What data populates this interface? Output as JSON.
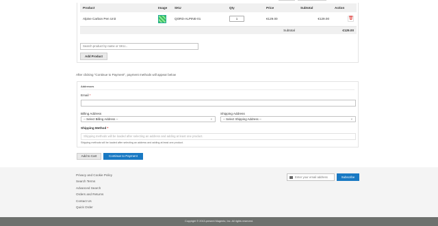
{
  "table": {
    "headers": [
      "Product",
      "Image",
      "SKU",
      "Qty",
      "Price",
      "Subtotal",
      "Action"
    ],
    "rows": [
      {
        "product": "Alpine Carbon Pen Unit",
        "sku": "QORD-ALPINE-01",
        "qty": "1",
        "price": "€129.00",
        "subtotal": "€129.00"
      }
    ],
    "subtotal_label": "Subtotal",
    "subtotal_value": "€129.00"
  },
  "search": {
    "placeholder": "Search product by name or SKU..."
  },
  "add_product_label": "Add Product",
  "payment_note": "After clicking \"Continue to Payment\", payment methods will appear below",
  "addresses": {
    "title": "Addresses",
    "email_label": "Email",
    "required_mark": "*",
    "billing_label": "Billing Address",
    "billing_selected": "-- Select Billing Address --",
    "shipping_label": "Shipping Address",
    "shipping_selected": "-- Select Shipping Address --",
    "shipping_method_label": "Shipping Method",
    "shipping_method_placeholder": "Shipping methods will be loaded after selecting an address and adding at least one product.",
    "shipping_method_note": "Shipping methods will be loaded after selecting an address and adding at least one product."
  },
  "buttons": {
    "add_to_cart": "Add to Cart",
    "continue_to_payment": "Continue to Payment"
  },
  "footer": {
    "links": [
      "Privacy and Cookie Policy",
      "Search Terms",
      "Advanced Search",
      "Orders and Returns",
      "Contact Us",
      "Quick Order"
    ],
    "newsletter_placeholder": "Enter your email address",
    "subscribe_label": "Subscribe",
    "copyright": "Copyright © 2013-present Magento, Inc. All rights reserved."
  },
  "colors": {
    "primary": "#1979c3",
    "danger": "#e02b27",
    "footer_bar": "#6e716e"
  },
  "icons": {
    "delete": "trash-icon",
    "select": "chevron-down-icon",
    "newsletter": "envelope-icon"
  }
}
